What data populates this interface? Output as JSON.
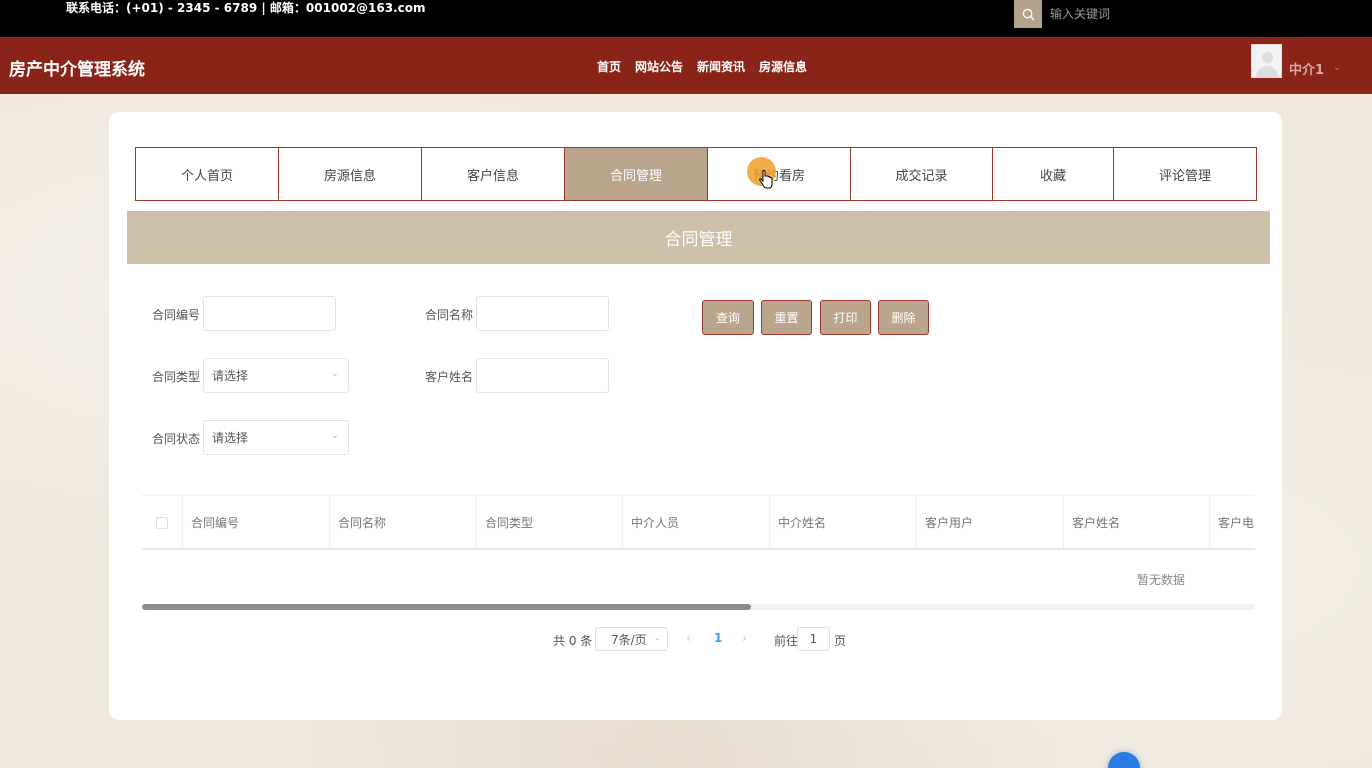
{
  "topbar": {
    "contact": "联系电话：(+01) - 2345 - 6789 | 邮箱：001002@163.com",
    "search_placeholder": "输入关键词",
    "search_icon": "search-icon"
  },
  "header": {
    "title": "房产中介管理系统",
    "nav": [
      "首页",
      "网站公告",
      "新闻资讯",
      "房源信息"
    ],
    "user_name": "中介1",
    "user_chevron_icon": "chevron-down-icon",
    "brand_color": "#8b2418"
  },
  "tabs": [
    {
      "label": "个人首页",
      "active": false
    },
    {
      "label": "房源信息",
      "active": false
    },
    {
      "label": "客户信息",
      "active": false
    },
    {
      "label": "合同管理",
      "active": true
    },
    {
      "label": "预约看房",
      "active": false
    },
    {
      "label": "成交记录",
      "active": false
    },
    {
      "label": "收藏",
      "active": false
    },
    {
      "label": "评论管理",
      "active": false
    }
  ],
  "section_title": "合同管理",
  "filters": {
    "contract_no_label": "合同编号",
    "contract_no_value": "",
    "contract_name_label": "合同名称",
    "contract_name_value": "",
    "contract_type_label": "合同类型",
    "contract_type_value": "请选择",
    "customer_name_label": "客户姓名",
    "customer_name_value": "",
    "contract_status_label": "合同状态",
    "contract_status_value": "请选择"
  },
  "buttons": {
    "query": "查询",
    "reset": "重置",
    "print": "打印",
    "delete": "删除"
  },
  "table": {
    "columns": [
      "合同编号",
      "合同名称",
      "合同类型",
      "中介人员",
      "中介姓名",
      "客户用户",
      "客户姓名",
      "客户电话"
    ],
    "rows": [],
    "empty_text": "暂无数据"
  },
  "pagination": {
    "total_text": "共 0 条",
    "page_size": "7条/页",
    "current_page": "1",
    "goto_label": "前往",
    "goto_value": "1",
    "page_suffix": "页",
    "prev_icon": "chevron-left-icon",
    "next_icon": "chevron-right-icon"
  },
  "colors": {
    "accent": "#bba58c",
    "section_bar": "#cdc0a8",
    "border": "#9b3a30",
    "link_active": "#409eff"
  }
}
